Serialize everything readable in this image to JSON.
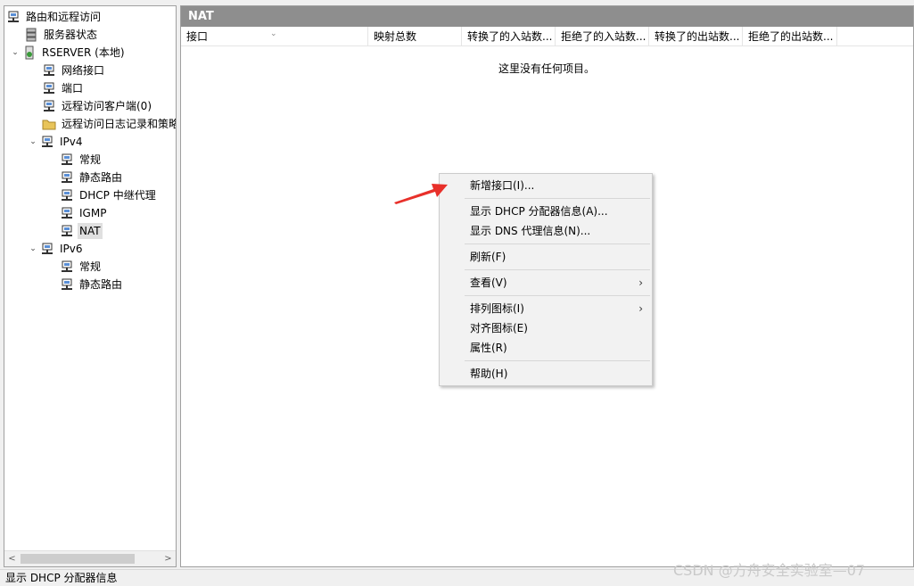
{
  "tree": {
    "items": [
      {
        "label": "路由和远程访问",
        "icon": "routing-server-icon",
        "expander": ""
      },
      {
        "label": "服务器状态",
        "icon": "server-status-icon",
        "expander": ""
      },
      {
        "label": "RSERVER (本地)",
        "icon": "server-local-icon",
        "expander": "⌄"
      },
      {
        "label": "网络接口",
        "icon": "network-interface-icon",
        "expander": ""
      },
      {
        "label": "端口",
        "icon": "ports-icon",
        "expander": ""
      },
      {
        "label": "远程访问客户端(0)",
        "icon": "remote-clients-icon",
        "expander": ""
      },
      {
        "label": "远程访问日志记录和策略",
        "icon": "folder-icon",
        "expander": ""
      },
      {
        "label": "IPv4",
        "icon": "ipv4-icon",
        "expander": "⌄"
      },
      {
        "label": "常规",
        "icon": "general-icon",
        "expander": ""
      },
      {
        "label": "静态路由",
        "icon": "static-route-icon",
        "expander": ""
      },
      {
        "label": "DHCP 中继代理",
        "icon": "dhcp-relay-icon",
        "expander": ""
      },
      {
        "label": "IGMP",
        "icon": "igmp-icon",
        "expander": ""
      },
      {
        "label": "NAT",
        "icon": "nat-icon",
        "expander": ""
      },
      {
        "label": "IPv6",
        "icon": "ipv6-icon",
        "expander": "⌄"
      },
      {
        "label": "常规",
        "icon": "general-icon",
        "expander": ""
      },
      {
        "label": "静态路由",
        "icon": "static-route-icon",
        "expander": ""
      }
    ],
    "selected": "NAT"
  },
  "scrollbar": {
    "left_arrow": "<",
    "right_arrow": ">"
  },
  "pane": {
    "title": "NAT",
    "columns": [
      "接口",
      "映射总数",
      "转换了的入站数...",
      "拒绝了的入站数...",
      "转换了的出站数...",
      "拒绝了的出站数..."
    ],
    "sort_caret": "⌄",
    "empty_message": "这里没有任何项目。"
  },
  "context_menu": {
    "items": [
      "新增接口(I)...",
      "显示 DHCP 分配器信息(A)...",
      "显示 DNS 代理信息(N)...",
      "刷新(F)",
      "查看(V)",
      "排列图标(I)",
      "对齐图标(E)",
      "属性(R)",
      "帮助(H)"
    ],
    "submenu_arrow": "›"
  },
  "annotation": {
    "color": "#e8302a"
  },
  "status_bar": {
    "text": "显示 DHCP 分配器信息"
  },
  "watermark": {
    "text": "CSDN @方舟安全实验室—07"
  }
}
